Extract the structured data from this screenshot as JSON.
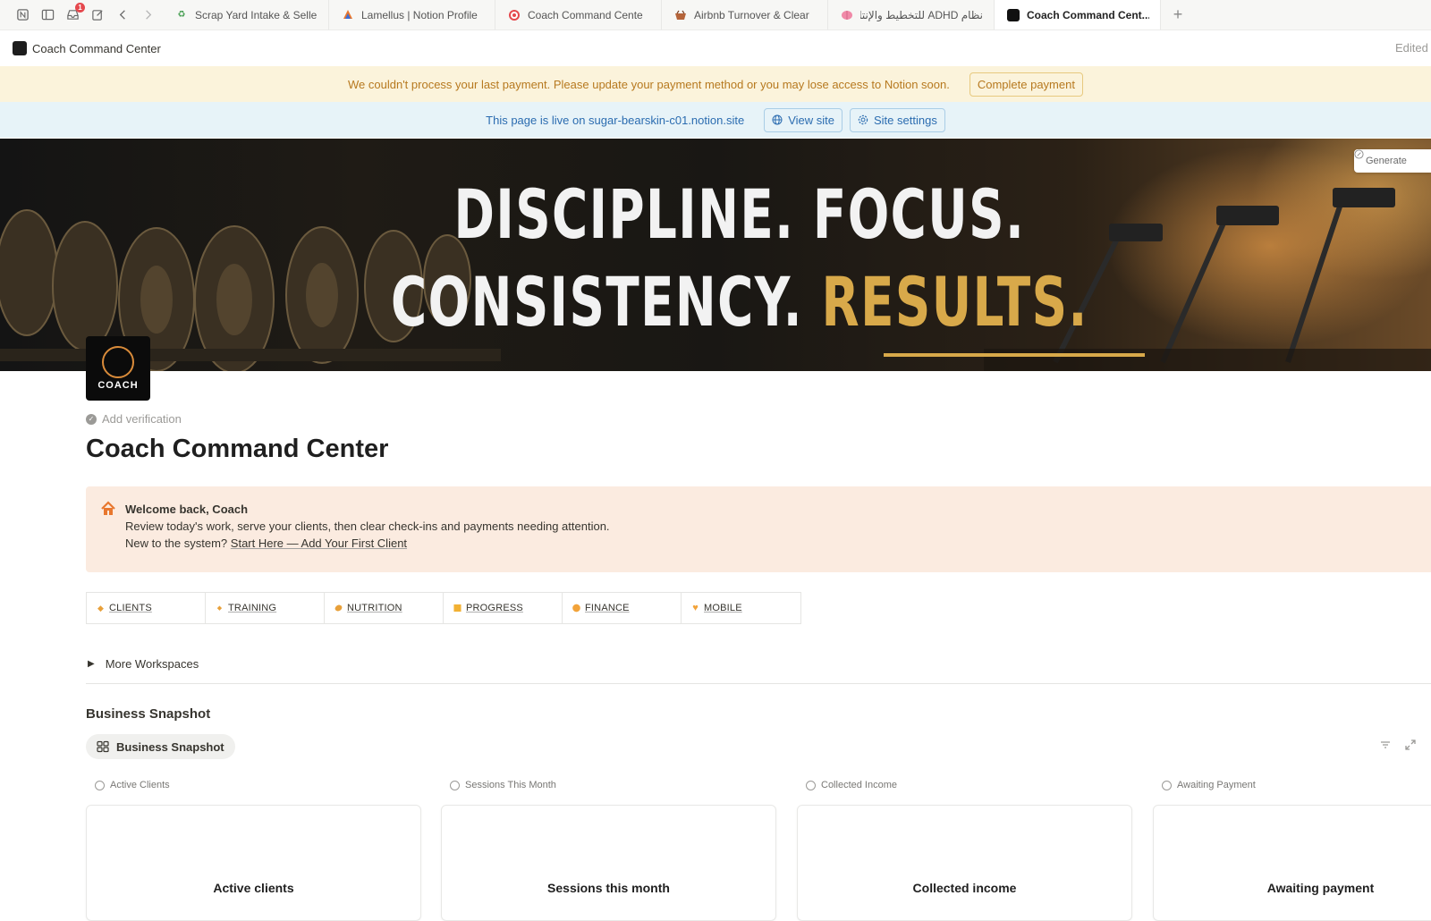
{
  "browser": {
    "notification_count": "1",
    "tabs": [
      {
        "label": "Scrap Yard Intake & Selle",
        "icon": "recycle-icon",
        "active": false
      },
      {
        "label": "Lamellus | Notion Profile",
        "icon": "lamellus-icon",
        "active": false
      },
      {
        "label": "Coach Command Cente",
        "icon": "target-icon",
        "active": false
      },
      {
        "label": "Airbnb Turnover & Clear",
        "icon": "basket-icon",
        "active": false
      },
      {
        "label": "نظام ADHD للتخطيط والإنتاجية",
        "icon": "brain-icon",
        "active": false
      },
      {
        "label": "Coach Command Cent...",
        "icon": "page-icon",
        "active": true
      }
    ]
  },
  "topbar": {
    "breadcrumb": "Coach Command Center",
    "edited": "Edited"
  },
  "payment_banner": {
    "message": "We couldn't process your last payment. Please update your payment method or you may lose access to Notion soon.",
    "button": "Complete payment"
  },
  "live_banner": {
    "message": "This page is live on sugar-bearskin-c01.notion.site",
    "view_site": "View site",
    "site_settings": "Site settings"
  },
  "cover": {
    "line1": "DISCIPLINE. FOCUS.",
    "line2_a": "CONSISTENCY.",
    "line2_b": "RESULTS.",
    "generate": "Generate"
  },
  "page_icon_text": "COACH",
  "add_verification": "Add verification",
  "title": "Coach Command Center",
  "callout": {
    "heading": "Welcome back, Coach",
    "line2": "Review today's work, serve your clients, then clear check-ins and payments needing attention.",
    "line3_prefix": "New to the system?",
    "line3_link": "Start Here — Add Your First Client"
  },
  "workspaces": [
    {
      "label": "CLIENTS",
      "icon": "diamond-icon",
      "color": "#e8a03a"
    },
    {
      "label": "TRAINING",
      "icon": "small-diamond-icon",
      "color": "#e8a03a"
    },
    {
      "label": "NUTRITION",
      "icon": "lemon-icon",
      "color": "#e8a03a"
    },
    {
      "label": "PROGRESS",
      "icon": "square-icon",
      "color": "#f2b134"
    },
    {
      "label": "FINANCE",
      "icon": "circle-icon",
      "color": "#f2a33a"
    },
    {
      "label": "MOBILE",
      "icon": "heart-icon",
      "color": "#f2a33a"
    }
  ],
  "more_workspaces": "More Workspaces",
  "business_snapshot": {
    "heading": "Business Snapshot",
    "view_tab": "Business Snapshot",
    "columns": [
      "Active Clients",
      "Sessions This Month",
      "Collected Income",
      "Awaiting Payment"
    ],
    "cards": [
      "Active clients",
      "Sessions this month",
      "Collected income",
      "Awaiting payment"
    ]
  }
}
